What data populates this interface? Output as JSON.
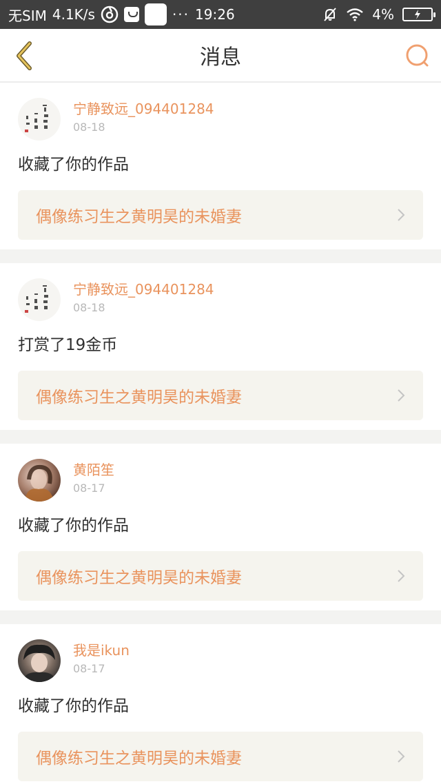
{
  "status_bar": {
    "carrier": "无SIM",
    "speed": "4.1K/s",
    "time": "19:26",
    "battery": "4%",
    "dots": "···"
  },
  "header": {
    "title": "消息"
  },
  "messages": [
    {
      "username": "宁静致远_094401284",
      "date": "08-18",
      "action": "收藏了你的作品",
      "work_title": "偶像练习生之黄明昊的未婚妻",
      "avatar": "calligraphy-avatar"
    },
    {
      "username": "宁静致远_094401284",
      "date": "08-18",
      "action": "打赏了19金币",
      "work_title": "偶像练习生之黄明昊的未婚妻",
      "avatar": "calligraphy-avatar"
    },
    {
      "username": "黄陌笙",
      "date": "08-17",
      "action": "收藏了你的作品",
      "work_title": "偶像练习生之黄明昊的未婚妻",
      "avatar": "photo-avatar"
    },
    {
      "username": "我是ikun",
      "date": "08-17",
      "action": "收藏了你的作品",
      "work_title": "偶像练习生之黄明昊的未婚妻",
      "avatar": "photo-avatar"
    }
  ],
  "colors": {
    "accent": "#e9935d",
    "status_bar_bg": "#3f3f3f",
    "card_bg": "#f5f4ee",
    "divider_bg": "#f3f3f1"
  },
  "icons": {
    "back": "back-chevron-icon",
    "search": "search-icon",
    "card_arrow": "chevron-right-icon"
  }
}
